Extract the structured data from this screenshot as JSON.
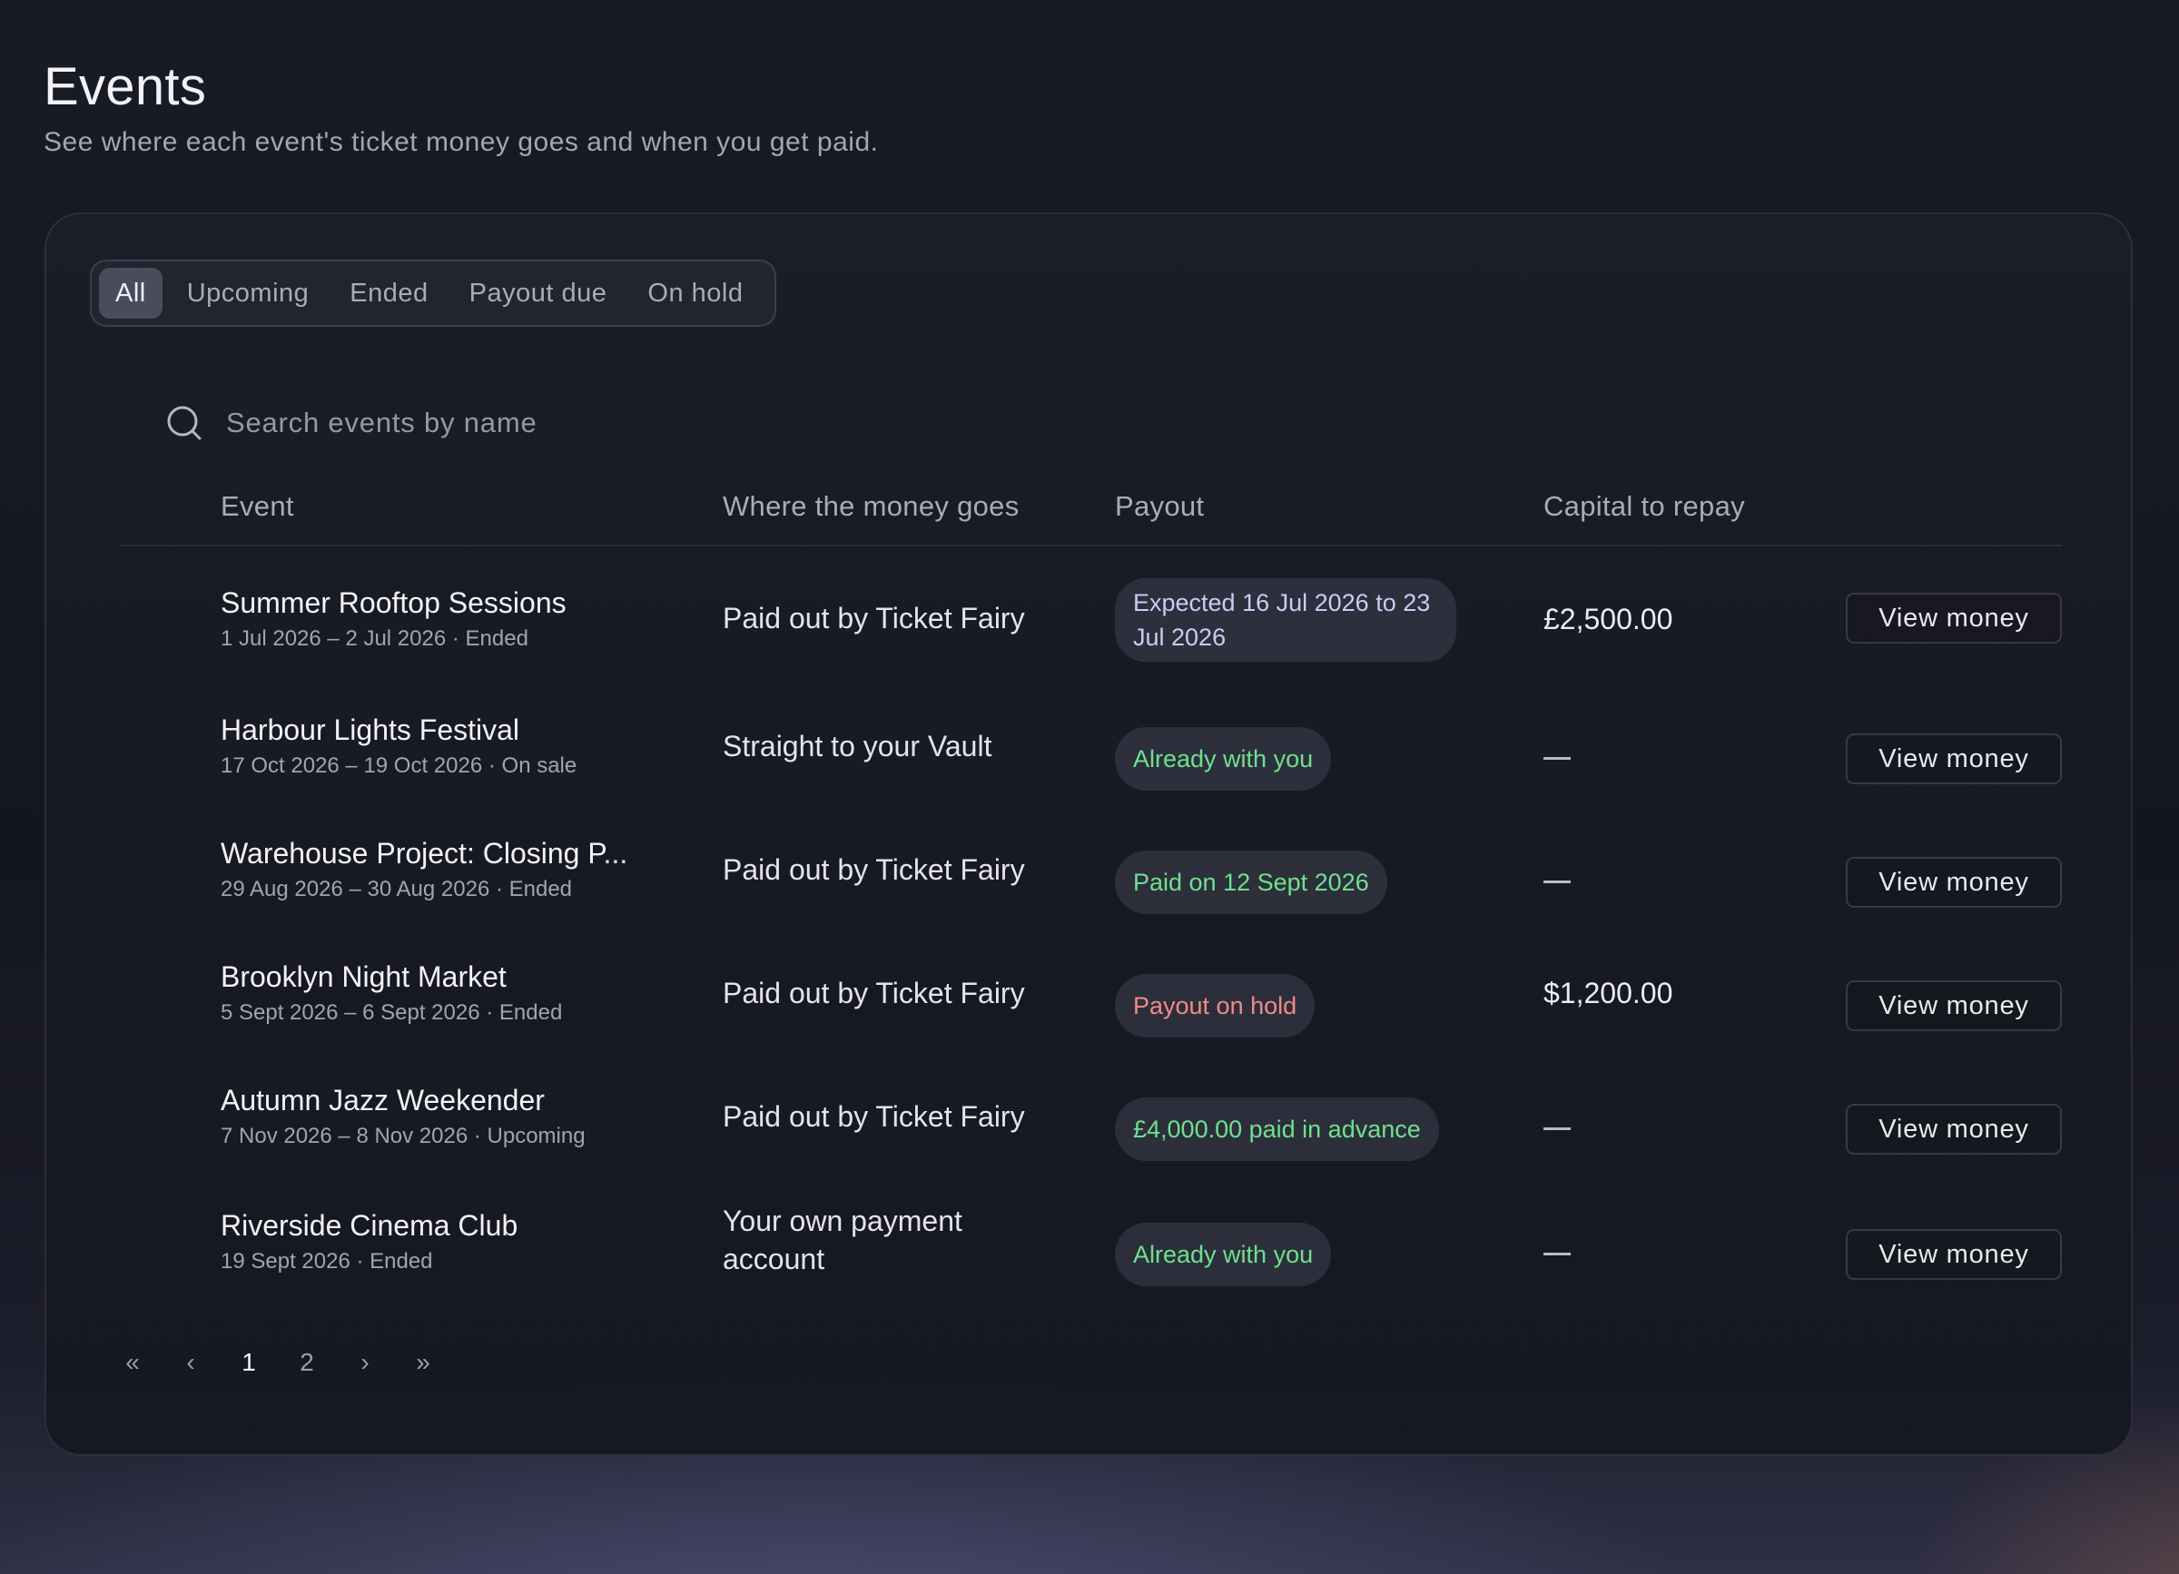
{
  "header": {
    "title": "Events",
    "subtitle": "See where each event's ticket money goes and when you get paid."
  },
  "tabs": [
    {
      "label": "All",
      "active": true
    },
    {
      "label": "Upcoming",
      "active": false
    },
    {
      "label": "Ended",
      "active": false
    },
    {
      "label": "Payout due",
      "active": false
    },
    {
      "label": "On hold",
      "active": false
    }
  ],
  "search": {
    "placeholder": "Search events by name",
    "value": "",
    "icon": "search-icon"
  },
  "table": {
    "columns": [
      "Event",
      "Where the money goes",
      "Payout",
      "Capital to repay"
    ],
    "rows": [
      {
        "name": "Summer Rooftop Sessions",
        "dates": "1 Jul 2026 – 2 Jul 2026 · Ended",
        "destination": "Paid out by Ticket Fairy",
        "payout": "Expected 16 Jul 2026 to 23 Jul 2026",
        "payout_status": "expected",
        "capital": "£2,500.00",
        "action": "View money"
      },
      {
        "name": "Harbour Lights Festival",
        "dates": "17 Oct 2026 – 19 Oct 2026 · On sale",
        "destination": "Straight to your Vault",
        "payout": "Already with you",
        "payout_status": "success",
        "capital": "—",
        "action": "View money"
      },
      {
        "name": "Warehouse Project: Closing P...",
        "dates": "29 Aug 2026 – 30 Aug 2026 · Ended",
        "destination": "Paid out by Ticket Fairy",
        "payout": "Paid on 12 Sept 2026",
        "payout_status": "success",
        "capital": "—",
        "action": "View money"
      },
      {
        "name": "Brooklyn Night Market",
        "dates": "5 Sept 2026 – 6 Sept 2026 · Ended",
        "destination": "Paid out by Ticket Fairy",
        "payout": "Payout on hold",
        "payout_status": "hold",
        "capital": "$1,200.00",
        "action": "View money"
      },
      {
        "name": "Autumn Jazz Weekender",
        "dates": "7 Nov 2026 – 8 Nov 2026 · Upcoming",
        "destination": "Paid out by Ticket Fairy",
        "payout": "£4,000.00 paid in advance",
        "payout_status": "success",
        "capital": "—",
        "action": "View money"
      },
      {
        "name": "Riverside Cinema Club",
        "dates": "19 Sept 2026 · Ended",
        "destination": "Your own payment account",
        "payout": "Already with you",
        "payout_status": "success",
        "capital": "—",
        "action": "View money"
      }
    ]
  },
  "pagination": {
    "first": "«",
    "prev": "‹",
    "pages": [
      "1",
      "2"
    ],
    "current": "1",
    "next": "›",
    "last": "»"
  },
  "colors": {
    "success": "#6fe08f",
    "hold": "#f08a86",
    "expected": "#c9cdf2",
    "active_tab": "#4a4c5e"
  }
}
